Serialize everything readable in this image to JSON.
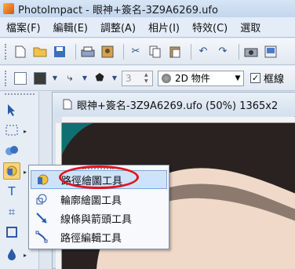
{
  "window": {
    "title": "PhotoImpact - 眼神+簽名-3Z9A6269.ufo"
  },
  "menu": {
    "items": [
      {
        "label": "檔案(F)"
      },
      {
        "label": "編輯(E)"
      },
      {
        "label": "調整(A)"
      },
      {
        "label": "相片(I)"
      },
      {
        "label": "特效(C)"
      },
      {
        "label": "選取"
      }
    ]
  },
  "toolbar": {
    "icons": [
      "new-icon",
      "open-icon",
      "save-icon",
      "scan-icon",
      "capture-icon",
      "cut-icon",
      "copy-icon",
      "paste-icon",
      "undo-icon",
      "redo-icon",
      "camera-icon",
      "view-icon"
    ]
  },
  "attributes": {
    "spin_value": "3",
    "object_mode": "2D 物件",
    "checkbox_label": "框線"
  },
  "document": {
    "title": "眼神+簽名-3Z9A6269.ufo (50%) 1365x2"
  },
  "flyout": {
    "items": [
      {
        "label": "路徑繪圖工具",
        "icon": "path-drawing-icon",
        "selected": true
      },
      {
        "label": "輪廓繪圖工具",
        "icon": "outline-drawing-icon",
        "selected": false
      },
      {
        "label": "線條與箭頭工具",
        "icon": "line-arrow-icon",
        "selected": false
      },
      {
        "label": "路徑編輯工具",
        "icon": "path-edit-icon",
        "selected": false
      }
    ]
  },
  "colors": {
    "photo_background": "#0f6f72",
    "highlight": "#e0141c",
    "selection": "#cfe2fb"
  }
}
